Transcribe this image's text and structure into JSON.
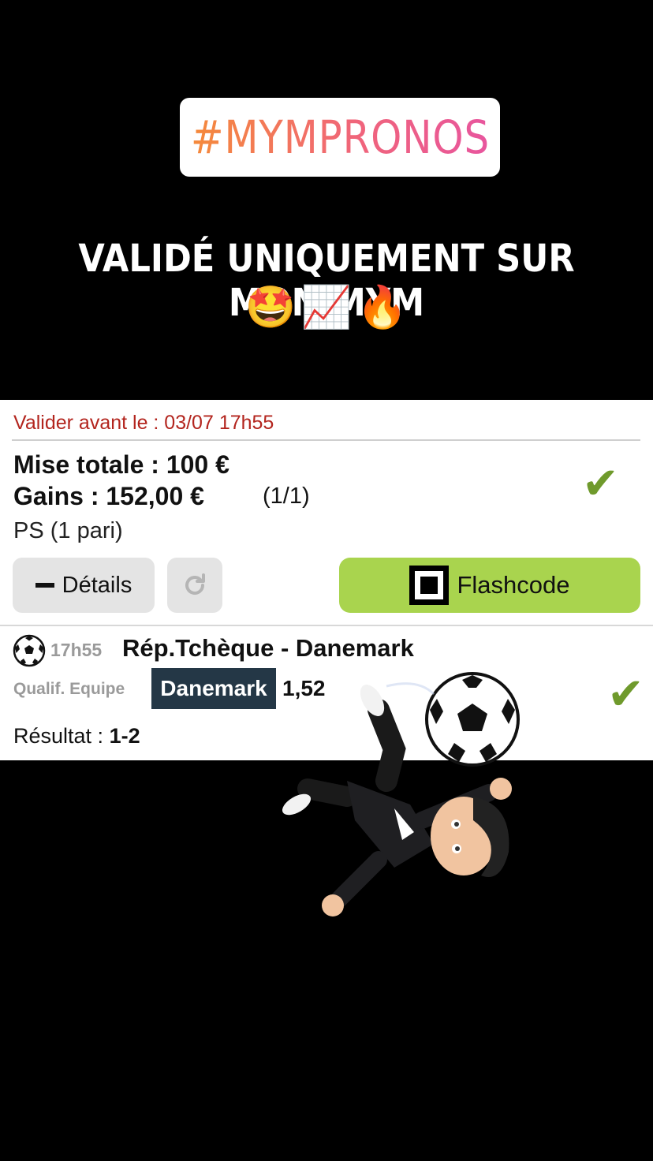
{
  "story": {
    "hashtag": "#MYMPRONOS",
    "caption": "VALIDÉ UNIQUEMENT SUR MON MYM",
    "emojis": [
      "🤩",
      "📈",
      "🔥"
    ]
  },
  "bet_card": {
    "deadline": "Valider avant le : 03/07 17h55",
    "stake": "Mise totale : 100 €",
    "gains": "Gains : 152,00 €",
    "gains_count": "(1/1)",
    "bet_type": "PS (1 pari)",
    "details_label": "Détails",
    "flashcode_label": "Flashcode",
    "status_color": "#6f9a2c"
  },
  "match": {
    "time": "17h55",
    "name": "Rép.Tchèque - Danemark",
    "market": "Qualif. Equipe",
    "selection": "Danemark",
    "odds": "1,52",
    "result_label": "Résultat : ",
    "result_value": "1-2"
  },
  "colors": {
    "background": "#000000",
    "deadline": "#b3251e",
    "flashcode_button": "#a9d44e",
    "selection_badge": "#243746"
  }
}
